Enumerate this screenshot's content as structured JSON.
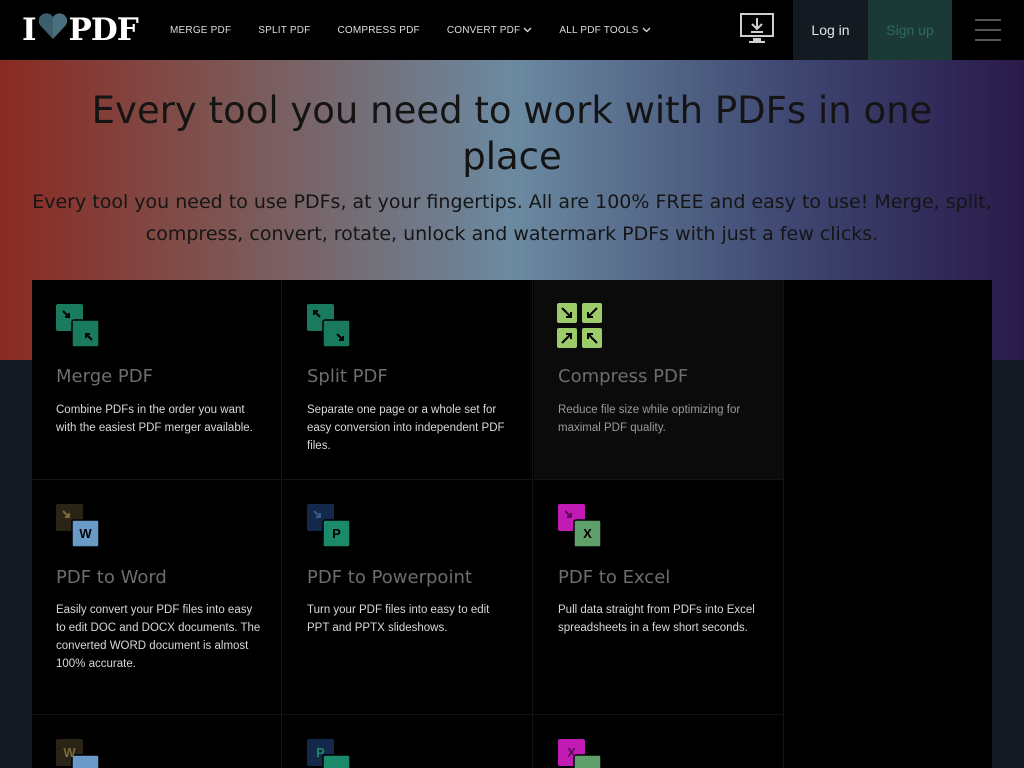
{
  "nav": {
    "logo_text_left": "I",
    "logo_text_right": "PDF",
    "links": [
      {
        "label": "MERGE PDF",
        "has_dropdown": false
      },
      {
        "label": "SPLIT PDF",
        "has_dropdown": false
      },
      {
        "label": "COMPRESS PDF",
        "has_dropdown": false
      },
      {
        "label": "CONVERT PDF",
        "has_dropdown": true
      },
      {
        "label": "ALL PDF TOOLS",
        "has_dropdown": true
      }
    ],
    "login_label": "Log in",
    "signup_label": "Sign up",
    "icons": {
      "desktop": "desktop-download-icon",
      "menu": "hamburger-menu-icon",
      "dropdown": "chevron-down-icon"
    }
  },
  "hero": {
    "title": "Every tool you need to work with PDFs in one place",
    "subtitle": "Every tool you need to use PDFs, at your fingertips. All are 100% FREE and easy to use! Merge, split, compress, convert, rotate, unlock and watermark PDFs with just a few clicks."
  },
  "tools": [
    {
      "title": "Merge PDF",
      "desc": "Combine PDFs in the order you want with the easiest PDF merger available.",
      "icon": "merge-pdf-icon"
    },
    {
      "title": "Split PDF",
      "desc": "Separate one page or a whole set for easy conversion into independent PDF files.",
      "icon": "split-pdf-icon"
    },
    {
      "title": "Compress PDF",
      "desc": "Reduce file size while optimizing for maximal PDF quality.",
      "icon": "compress-pdf-icon"
    },
    {
      "title": "PDF to Word",
      "desc": "Easily convert your PDF files into easy to edit DOC and DOCX documents. The converted WORD document is almost 100% accurate.",
      "icon": "pdf-to-word-icon",
      "badge": "W"
    },
    {
      "title": "PDF to Powerpoint",
      "desc": "Turn your PDF files into easy to edit PPT and PPTX slideshows.",
      "icon": "pdf-to-powerpoint-icon",
      "badge": "P"
    },
    {
      "title": "PDF to Excel",
      "desc": "Pull data straight from PDFs into Excel spreadsheets in a few short seconds.",
      "icon": "pdf-to-excel-icon",
      "badge": "X"
    },
    {
      "title": "",
      "desc": "",
      "icon": "word-to-pdf-icon",
      "badge": "W"
    },
    {
      "title": "",
      "desc": "",
      "icon": "powerpoint-to-pdf-icon",
      "badge": "P"
    },
    {
      "title": "",
      "desc": "",
      "icon": "excel-to-pdf-icon",
      "badge": "X"
    }
  ],
  "colors": {
    "brand_green": "#1a7a5e",
    "compress_green": "#9ccc6a",
    "signup_bg": "#1b3a35",
    "word_blue": "#6a9bc8",
    "ppt_green": "#1a8a6a",
    "excel_magenta": "#c21bb5"
  }
}
